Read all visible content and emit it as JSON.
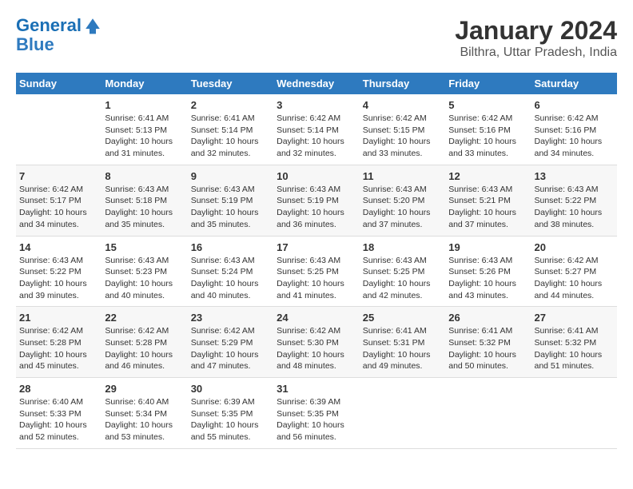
{
  "logo": {
    "line1": "General",
    "line2": "Blue"
  },
  "title": "January 2024",
  "subtitle": "Bilthra, Uttar Pradesh, India",
  "headers": [
    "Sunday",
    "Monday",
    "Tuesday",
    "Wednesday",
    "Thursday",
    "Friday",
    "Saturday"
  ],
  "weeks": [
    [
      {
        "day": "",
        "sunrise": "",
        "sunset": "",
        "daylight": ""
      },
      {
        "day": "1",
        "sunrise": "Sunrise: 6:41 AM",
        "sunset": "Sunset: 5:13 PM",
        "daylight": "Daylight: 10 hours and 31 minutes."
      },
      {
        "day": "2",
        "sunrise": "Sunrise: 6:41 AM",
        "sunset": "Sunset: 5:14 PM",
        "daylight": "Daylight: 10 hours and 32 minutes."
      },
      {
        "day": "3",
        "sunrise": "Sunrise: 6:42 AM",
        "sunset": "Sunset: 5:14 PM",
        "daylight": "Daylight: 10 hours and 32 minutes."
      },
      {
        "day": "4",
        "sunrise": "Sunrise: 6:42 AM",
        "sunset": "Sunset: 5:15 PM",
        "daylight": "Daylight: 10 hours and 33 minutes."
      },
      {
        "day": "5",
        "sunrise": "Sunrise: 6:42 AM",
        "sunset": "Sunset: 5:16 PM",
        "daylight": "Daylight: 10 hours and 33 minutes."
      },
      {
        "day": "6",
        "sunrise": "Sunrise: 6:42 AM",
        "sunset": "Sunset: 5:16 PM",
        "daylight": "Daylight: 10 hours and 34 minutes."
      }
    ],
    [
      {
        "day": "7",
        "sunrise": "Sunrise: 6:42 AM",
        "sunset": "Sunset: 5:17 PM",
        "daylight": "Daylight: 10 hours and 34 minutes."
      },
      {
        "day": "8",
        "sunrise": "Sunrise: 6:43 AM",
        "sunset": "Sunset: 5:18 PM",
        "daylight": "Daylight: 10 hours and 35 minutes."
      },
      {
        "day": "9",
        "sunrise": "Sunrise: 6:43 AM",
        "sunset": "Sunset: 5:19 PM",
        "daylight": "Daylight: 10 hours and 35 minutes."
      },
      {
        "day": "10",
        "sunrise": "Sunrise: 6:43 AM",
        "sunset": "Sunset: 5:19 PM",
        "daylight": "Daylight: 10 hours and 36 minutes."
      },
      {
        "day": "11",
        "sunrise": "Sunrise: 6:43 AM",
        "sunset": "Sunset: 5:20 PM",
        "daylight": "Daylight: 10 hours and 37 minutes."
      },
      {
        "day": "12",
        "sunrise": "Sunrise: 6:43 AM",
        "sunset": "Sunset: 5:21 PM",
        "daylight": "Daylight: 10 hours and 37 minutes."
      },
      {
        "day": "13",
        "sunrise": "Sunrise: 6:43 AM",
        "sunset": "Sunset: 5:22 PM",
        "daylight": "Daylight: 10 hours and 38 minutes."
      }
    ],
    [
      {
        "day": "14",
        "sunrise": "Sunrise: 6:43 AM",
        "sunset": "Sunset: 5:22 PM",
        "daylight": "Daylight: 10 hours and 39 minutes."
      },
      {
        "day": "15",
        "sunrise": "Sunrise: 6:43 AM",
        "sunset": "Sunset: 5:23 PM",
        "daylight": "Daylight: 10 hours and 40 minutes."
      },
      {
        "day": "16",
        "sunrise": "Sunrise: 6:43 AM",
        "sunset": "Sunset: 5:24 PM",
        "daylight": "Daylight: 10 hours and 40 minutes."
      },
      {
        "day": "17",
        "sunrise": "Sunrise: 6:43 AM",
        "sunset": "Sunset: 5:25 PM",
        "daylight": "Daylight: 10 hours and 41 minutes."
      },
      {
        "day": "18",
        "sunrise": "Sunrise: 6:43 AM",
        "sunset": "Sunset: 5:25 PM",
        "daylight": "Daylight: 10 hours and 42 minutes."
      },
      {
        "day": "19",
        "sunrise": "Sunrise: 6:43 AM",
        "sunset": "Sunset: 5:26 PM",
        "daylight": "Daylight: 10 hours and 43 minutes."
      },
      {
        "day": "20",
        "sunrise": "Sunrise: 6:42 AM",
        "sunset": "Sunset: 5:27 PM",
        "daylight": "Daylight: 10 hours and 44 minutes."
      }
    ],
    [
      {
        "day": "21",
        "sunrise": "Sunrise: 6:42 AM",
        "sunset": "Sunset: 5:28 PM",
        "daylight": "Daylight: 10 hours and 45 minutes."
      },
      {
        "day": "22",
        "sunrise": "Sunrise: 6:42 AM",
        "sunset": "Sunset: 5:28 PM",
        "daylight": "Daylight: 10 hours and 46 minutes."
      },
      {
        "day": "23",
        "sunrise": "Sunrise: 6:42 AM",
        "sunset": "Sunset: 5:29 PM",
        "daylight": "Daylight: 10 hours and 47 minutes."
      },
      {
        "day": "24",
        "sunrise": "Sunrise: 6:42 AM",
        "sunset": "Sunset: 5:30 PM",
        "daylight": "Daylight: 10 hours and 48 minutes."
      },
      {
        "day": "25",
        "sunrise": "Sunrise: 6:41 AM",
        "sunset": "Sunset: 5:31 PM",
        "daylight": "Daylight: 10 hours and 49 minutes."
      },
      {
        "day": "26",
        "sunrise": "Sunrise: 6:41 AM",
        "sunset": "Sunset: 5:32 PM",
        "daylight": "Daylight: 10 hours and 50 minutes."
      },
      {
        "day": "27",
        "sunrise": "Sunrise: 6:41 AM",
        "sunset": "Sunset: 5:32 PM",
        "daylight": "Daylight: 10 hours and 51 minutes."
      }
    ],
    [
      {
        "day": "28",
        "sunrise": "Sunrise: 6:40 AM",
        "sunset": "Sunset: 5:33 PM",
        "daylight": "Daylight: 10 hours and 52 minutes."
      },
      {
        "day": "29",
        "sunrise": "Sunrise: 6:40 AM",
        "sunset": "Sunset: 5:34 PM",
        "daylight": "Daylight: 10 hours and 53 minutes."
      },
      {
        "day": "30",
        "sunrise": "Sunrise: 6:39 AM",
        "sunset": "Sunset: 5:35 PM",
        "daylight": "Daylight: 10 hours and 55 minutes."
      },
      {
        "day": "31",
        "sunrise": "Sunrise: 6:39 AM",
        "sunset": "Sunset: 5:35 PM",
        "daylight": "Daylight: 10 hours and 56 minutes."
      },
      {
        "day": "",
        "sunrise": "",
        "sunset": "",
        "daylight": ""
      },
      {
        "day": "",
        "sunrise": "",
        "sunset": "",
        "daylight": ""
      },
      {
        "day": "",
        "sunrise": "",
        "sunset": "",
        "daylight": ""
      }
    ]
  ]
}
